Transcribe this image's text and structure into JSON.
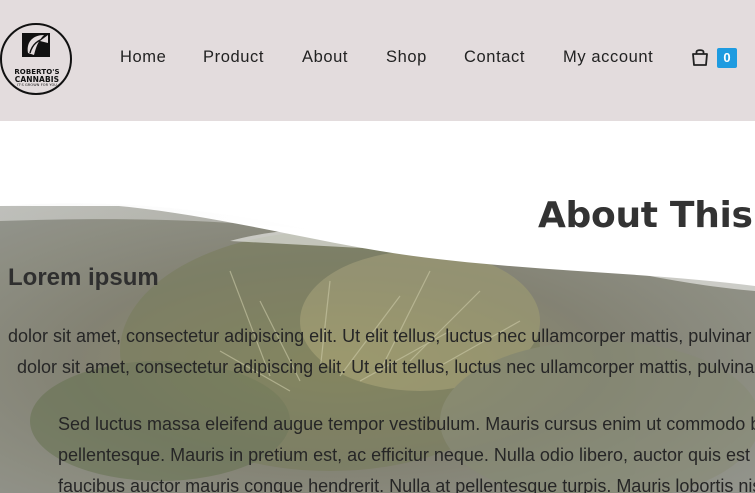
{
  "logo": {
    "line1": "ROBERTO'S",
    "line2": "CANNABIS",
    "tagline": "IT'S GROWN FOR YOU"
  },
  "nav": {
    "items": [
      {
        "label": "Home"
      },
      {
        "label": "Product"
      },
      {
        "label": "About"
      },
      {
        "label": "Shop"
      },
      {
        "label": "Contact"
      },
      {
        "label": "My account"
      }
    ]
  },
  "cart": {
    "count": "0",
    "icon": "shopping-bag-icon"
  },
  "hero": {
    "title": "About This F",
    "heading": "Lorem ipsum",
    "line1": "dolor sit amet, consectetur adipiscing elit. Ut elit tellus, luctus nec ullamcorper mattis, pulvinar da",
    "line2": "dolor sit amet, consectetur adipiscing elit. Ut elit tellus, luctus nec ullamcorper mattis, pulvinar d",
    "para2_line1": "Sed luctus massa eleifend augue tempor vestibulum. Mauris cursus enim ut commodo bla",
    "para2_line2": "pellentesque. Mauris in pretium est, ac efficitur neque. Nulla odio libero, auctor quis est no",
    "para2_line3": "faucibus auctor mauris congue hendrerit. Nulla at pellentesque turpis. Mauris lobortis nisl"
  },
  "colors": {
    "header_bg": "#e3dcdd",
    "accent": "#1e9be0"
  }
}
